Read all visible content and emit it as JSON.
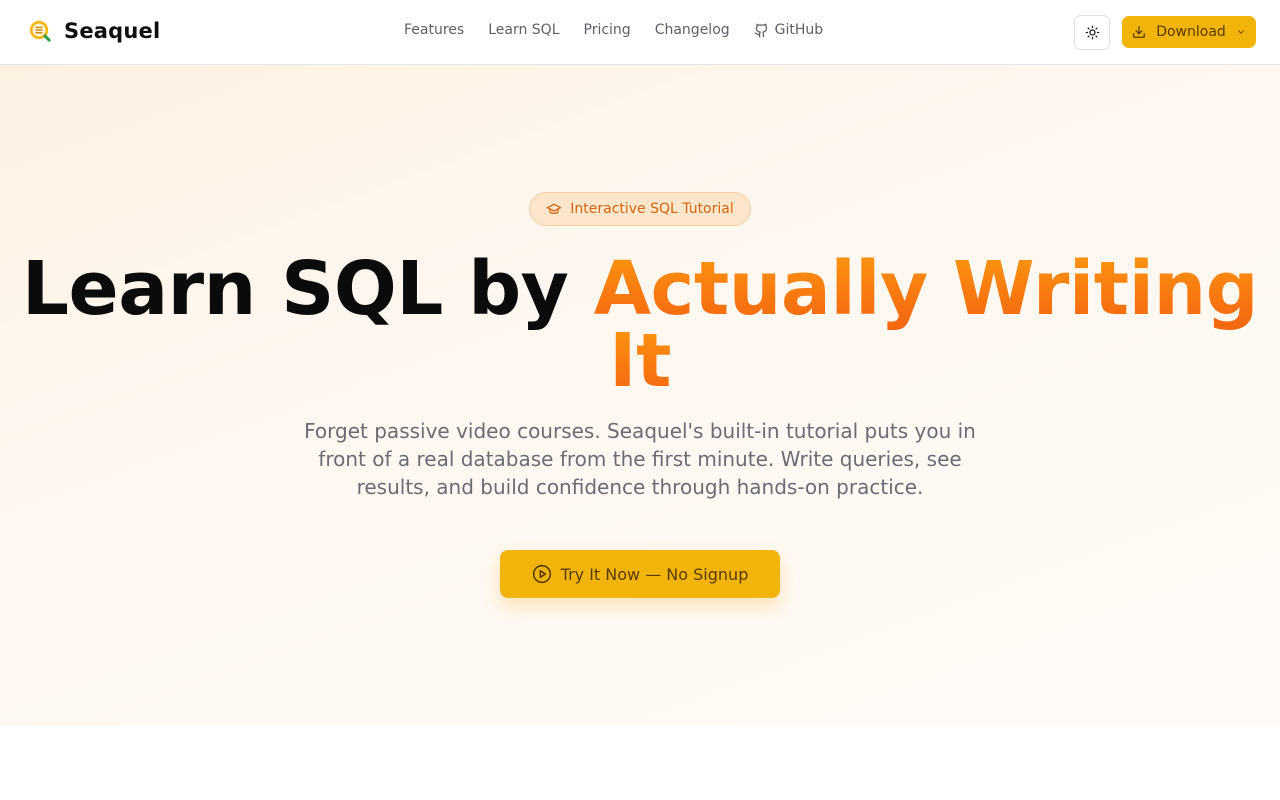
{
  "header": {
    "brand_name": "Seaquel",
    "brand_icon": "seaquel-logo-icon",
    "nav": [
      {
        "label": "Features"
      },
      {
        "label": "Learn SQL"
      },
      {
        "label": "Pricing"
      },
      {
        "label": "Changelog"
      },
      {
        "label": "GitHub",
        "icon": "github-icon"
      }
    ],
    "theme_toggle_icon": "sun-icon",
    "download_label": "Download"
  },
  "hero": {
    "badge": {
      "icon": "graduation-cap-icon",
      "label": "Interactive SQL Tutorial"
    },
    "headline_part1": "Learn SQL by ",
    "headline_part2": "Actually Writing It",
    "subtitle": "Forget passive video courses. Seaquel's built-in tutorial puts you in front of a real database from the first minute. Write queries, see results, and build confidence through hands-on practice.",
    "cta": {
      "icon": "play-circle-icon",
      "label": "Try It Now — No Signup"
    }
  },
  "colors": {
    "accent": "#f1b40b",
    "headline_accent": "#f97a10",
    "badge_text": "#d2650a",
    "text_primary": "#0b0b0c",
    "text_muted": "#6b6b73"
  }
}
